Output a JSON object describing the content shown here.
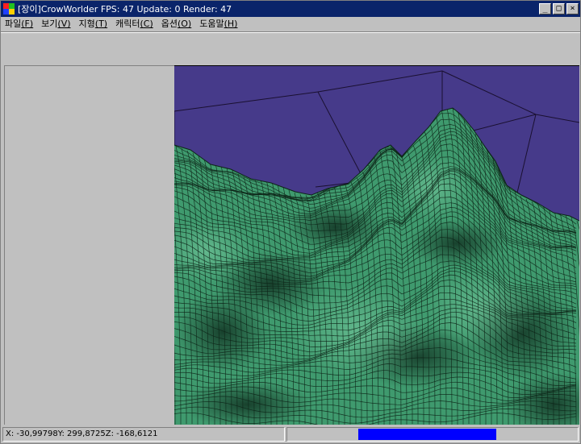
{
  "window": {
    "title": "[장이]CrowWorlder   FPS: 47 Update: 0 Render: 47",
    "minimize_glyph": "_",
    "maximize_glyph": "□",
    "close_glyph": "×"
  },
  "menu": [
    {
      "label": "파일",
      "mnemonic": "(F)"
    },
    {
      "label": "보기",
      "mnemonic": "(V)"
    },
    {
      "label": "지형",
      "mnemonic": "(T)"
    },
    {
      "label": "캐릭터",
      "mnemonic": "(C)"
    },
    {
      "label": "옵션",
      "mnemonic": "(O)"
    },
    {
      "label": "도움말",
      "mnemonic": "(H)"
    }
  ],
  "viewport": {
    "sky_color": "#463a8a",
    "terrain_color": "#3f9a6e",
    "wire_color": "#0d2418"
  },
  "status": {
    "coords": "X: -30,99798Y: 299,8725Z: -168,6121",
    "progress_color": "#0000ff"
  }
}
